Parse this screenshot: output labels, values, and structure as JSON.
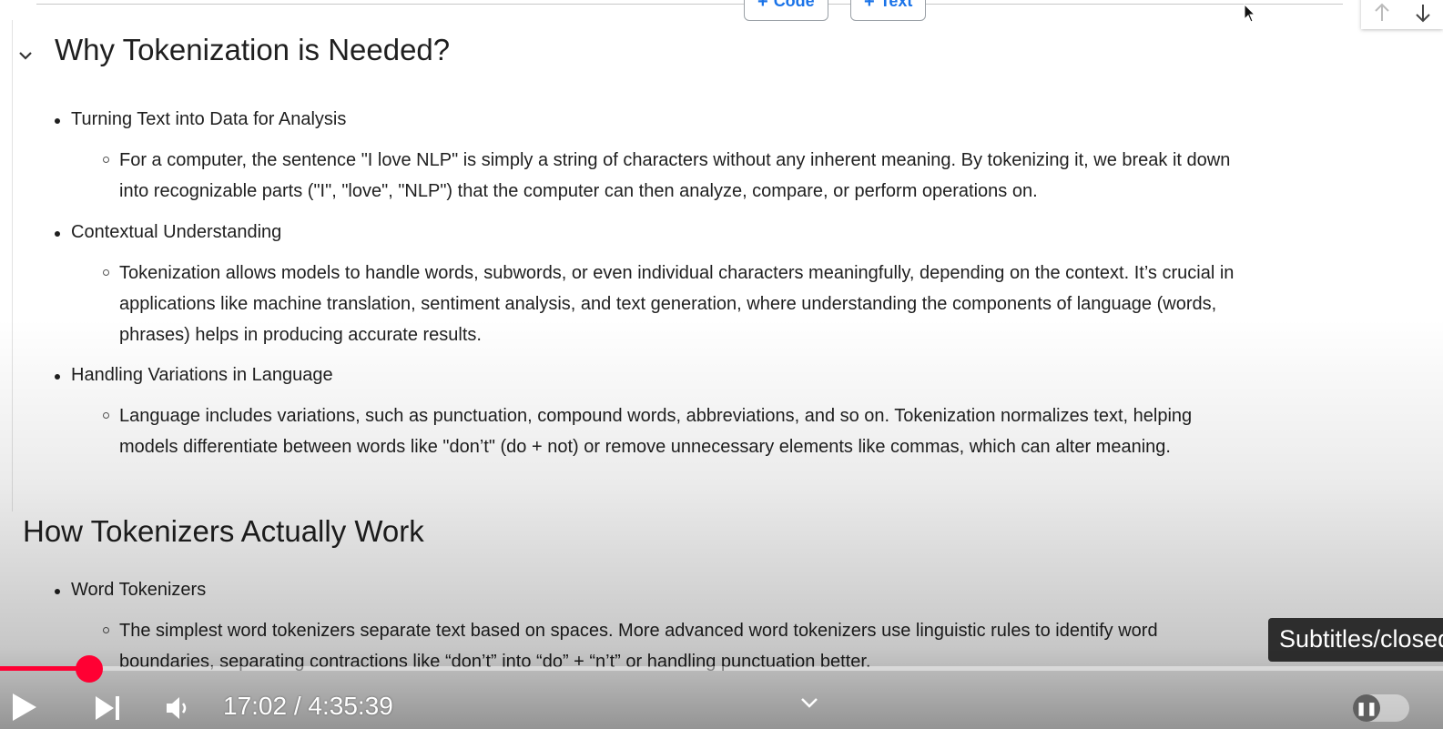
{
  "toolbar": {
    "add_code_label": "Code",
    "add_text_label": "Text",
    "add_glyph": "+"
  },
  "section1": {
    "heading": "Why Tokenization is Needed?",
    "items": [
      {
        "title": "Turning Text into Data for Analysis",
        "detail": "For a computer, the sentence \"I love NLP\" is simply a string of characters without any inherent meaning. By tokenizing it, we break it down into recognizable parts (\"I\", \"love\", \"NLP\") that the computer can then analyze, compare, or perform operations on."
      },
      {
        "title": "Contextual Understanding",
        "detail": "Tokenization allows models to handle words, subwords, or even individual characters meaningfully, depending on the context. It’s crucial in applications like machine translation, sentiment analysis, and text generation, where understanding the components of language (words, phrases) helps in producing accurate results."
      },
      {
        "title": "Handling Variations in Language",
        "detail": "Language includes variations, such as punctuation, compound words, abbreviations, and so on. Tokenization normalizes text, helping models differentiate between words like \"don’t\" (do + not) or remove unnecessary elements like commas, which can alter meaning."
      }
    ]
  },
  "section2": {
    "heading": "How Tokenizers Actually Work",
    "items": [
      {
        "title": "Word Tokenizers",
        "detail": "The simplest word tokenizers separate text based on spaces. More advanced word tokenizers use linguistic rules to identify word boundaries, separating contractions like “don’t” into “do” + “n’t” or handling punctuation better."
      }
    ]
  },
  "player": {
    "current_time": "17:02",
    "duration": "4:35:39",
    "time_display": "17:02 / 4:35:39",
    "progress_fraction": 0.0617,
    "tooltip": "Subtitles/closed captions",
    "autoplay_on": false,
    "accent_color": "#ff0033"
  }
}
